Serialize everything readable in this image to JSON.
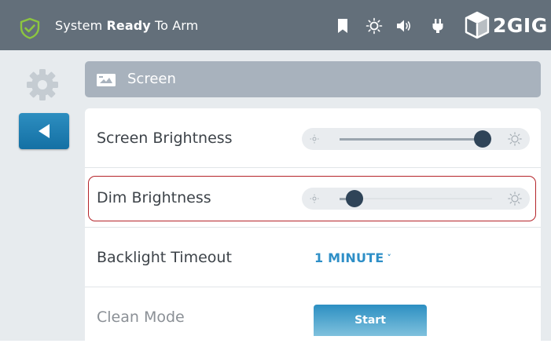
{
  "status_bar": {
    "prefix": "System",
    "emphasis": "Ready",
    "suffix": "To Arm",
    "icons": [
      "shield-check-icon",
      "bookmark-icon",
      "sun-icon",
      "speaker-icon",
      "plug-icon"
    ],
    "logo": "2GIG"
  },
  "header": {
    "title": "Screen",
    "icon": "screen-icon"
  },
  "settings": {
    "screen_brightness": {
      "label": "Screen Brightness",
      "level": 0.94
    },
    "dim_brightness": {
      "label": "Dim Brightness",
      "level": 0.1
    },
    "backlight_timeout": {
      "label": "Backlight Timeout",
      "value": "1 MINUTE"
    },
    "clean_mode": {
      "label": "Clean Mode",
      "button": "Start"
    }
  },
  "colors": {
    "topbar": "#636f7a",
    "accent": "#2e8fc7",
    "highlight": "#b5242a",
    "knob": "#2f4458"
  }
}
